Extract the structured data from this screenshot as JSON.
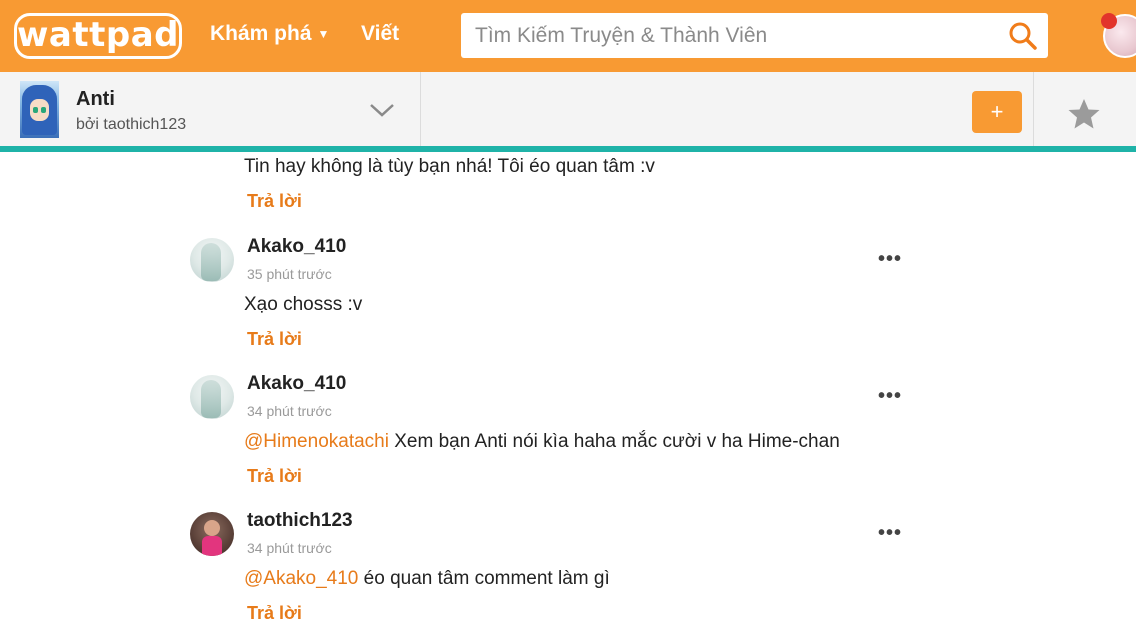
{
  "topbar": {
    "logo": "wattpad",
    "discover_label": "Khám phá",
    "write_label": "Viết",
    "search_placeholder": "Tìm Kiếm Truyện & Thành Viên"
  },
  "story": {
    "title": "Anti",
    "author": "bởi taothich123",
    "add_label": "+"
  },
  "colors": {
    "brand_orange": "#f89a33",
    "accent_teal": "#1fb3a8",
    "mention_orange": "#e77b1a"
  },
  "comments": [
    {
      "text": "Tin hay không là tùy bạn nhá! Tôi éo quan tâm :v",
      "reply_label": "Trả lời"
    },
    {
      "username": "Akako_410",
      "time": "35 phút trước",
      "text": "Xạo chosss :v",
      "reply_label": "Trả lời"
    },
    {
      "username": "Akako_410",
      "time": "34 phút trước",
      "mention": "@Himenokatachi",
      "text": " Xem bạn Anti nói kìa haha mắc cười v ha Hime-chan",
      "reply_label": "Trả lời"
    },
    {
      "username": "taothich123",
      "time": "34 phút trước",
      "mention": "@Akako_410",
      "text": " éo quan tâm comment làm gì",
      "reply_label": "Trả lời"
    }
  ],
  "more_label": "•••"
}
